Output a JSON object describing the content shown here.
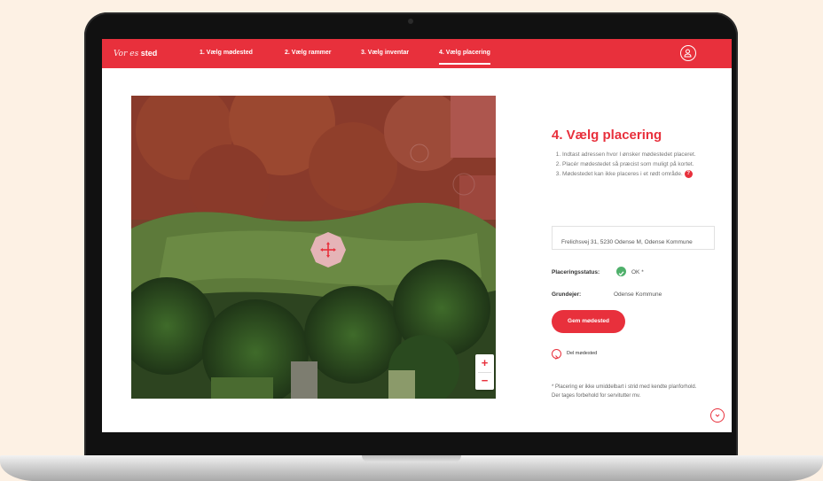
{
  "nav": {
    "logo_script": "Vor es",
    "logo_bold": "sted",
    "steps": [
      {
        "label": "1. Vælg mødested"
      },
      {
        "label": "2. Vælg rammer"
      },
      {
        "label": "3. Vælg inventar"
      },
      {
        "label": "4. Vælg placering"
      }
    ],
    "active_step": 4
  },
  "map": {
    "zoom_in": "+",
    "zoom_out": "−"
  },
  "panel": {
    "title": "4. Vælg placering",
    "instructions": [
      "Indtast adressen hvor I ønsker mødestedet placeret.",
      "Placér mødestedet så præcist som muligt på kortet.",
      "Mødestedet kan ikke placeres i et rødt område."
    ],
    "help_icon": "?",
    "address_value": "Frelichsvej 31, 5230 Odense M, Odense Kommune",
    "status_label": "Placeringsstatus:",
    "status_value": "OK *",
    "owner_label": "Grundejer:",
    "owner_value": "Odense Kommune",
    "save_label": "Gem mødested",
    "share_label": "Del mødested",
    "footnote": "* Placering er ikke umiddelbart i strid med kendte planforhold. Der tages forbehold for servitutter mv."
  },
  "colors": {
    "accent": "#e8303c",
    "ok": "#4fb06b",
    "background": "#fdf1e4"
  },
  "icons": [
    "user-icon",
    "move-icon",
    "check-icon",
    "chevron-right-icon",
    "chevron-down-icon",
    "question-icon"
  ]
}
